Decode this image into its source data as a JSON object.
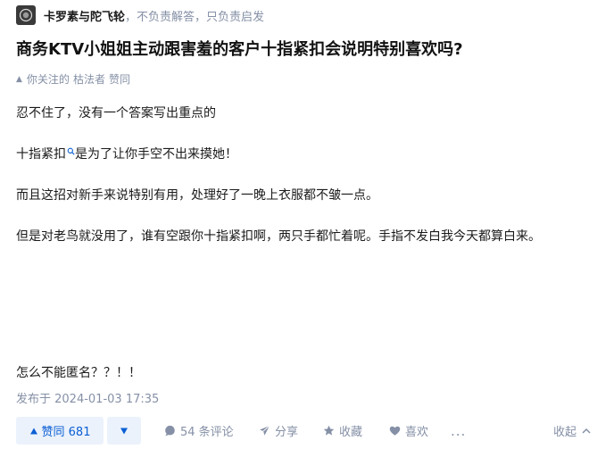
{
  "author": {
    "name": "卡罗素与陀飞轮",
    "bio": "，不负责解答，只负责启发"
  },
  "question": {
    "title": "商务KTV小姐姐主动跟害羞的客户十指紧扣会说明特别喜欢吗?"
  },
  "activity": {
    "prefix": "你关注的",
    "user": "枯法者",
    "action": "赞同"
  },
  "answer": {
    "paragraphs": [
      "忍不住了，没有一个答案写出重点的",
      "是为了让你手空不出来摸她！",
      "而且这招对新手来说特别有用，处理好了一晚上衣服都不皱一点。",
      "但是对老鸟就没用了，谁有空跟你十指紧扣啊，两只手都忙着呢。手指不发白我今天都算白来。",
      "怎么不能匿名？？！！"
    ],
    "keyword": "十指紧扣",
    "keyword_icon": "search-icon",
    "published": "发布于 2024-01-03 17:35"
  },
  "actions": {
    "upvote_label": "赞同 681",
    "downvote_icon": "triangle-down-icon",
    "comment_label": "54 条评论",
    "share_label": "分享",
    "favorite_label": "收藏",
    "like_label": "喜欢",
    "more_label": "...",
    "collapse_label": "收起"
  },
  "colors": {
    "accent": "#0b5fd3",
    "accent_bg": "#ebf2fc",
    "muted": "#8590a6",
    "text": "#1a1a1a"
  }
}
